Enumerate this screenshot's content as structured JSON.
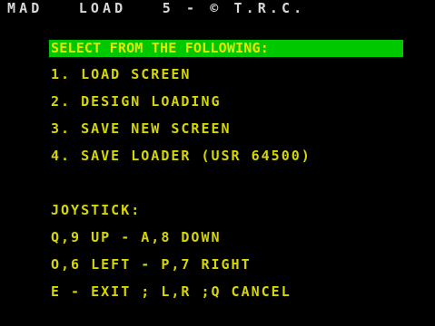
{
  "title": "MAD   LOAD   5 - © T.R.C.",
  "prompt": "SELECT FROM THE FOLLOWING:",
  "menu": [
    {
      "label": "1. LOAD SCREEN"
    },
    {
      "label": "2. DESIGN LOADING"
    },
    {
      "label": "3. SAVE NEW SCREEN"
    },
    {
      "label": "4. SAVE LOADER (USR 64500)"
    }
  ],
  "joystick": {
    "heading": "JOYSTICK:",
    "lines": [
      "Q,9 UP - A,8 DOWN",
      "O,6 LEFT - P,7 RIGHT",
      "E - EXIT ; L,R ;Q CANCEL"
    ]
  },
  "colors": {
    "background": "#000000",
    "title_text": "#d8d8d8",
    "prompt_bg": "#00c800",
    "prompt_text": "#e6e600",
    "menu_text": "#d6d600"
  }
}
